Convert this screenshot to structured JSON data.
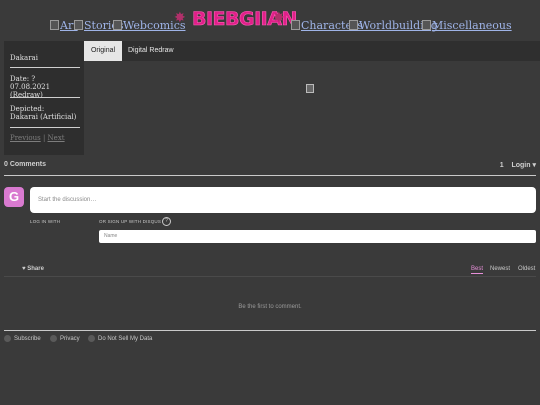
{
  "nav": {
    "links": [
      "Art",
      "Stories",
      "Webcomics",
      "Characters",
      "Worldbuilding",
      "Miscellaneous"
    ],
    "logo_text": "BIEBGIIAN"
  },
  "info": {
    "name": "Dakarai",
    "date_label": "Date: ?",
    "date_value": "07.08.2021 (Redraw)",
    "depicted_label": "Depicted:",
    "depicted_value": "Dakarai (Artificial)",
    "prev": "Previous",
    "separator": "|",
    "next": "Next"
  },
  "tabs": [
    "Original",
    "Digital Redraw"
  ],
  "comments": {
    "count_label": "0 Comments",
    "notif_count": "1",
    "login_label": "Login ▾",
    "avatar_letter": "G",
    "placeholder": "Start the discussion…",
    "log_in_with": "LOG IN WITH",
    "sign_up": "OR SIGN UP WITH DISQUS",
    "help": "?",
    "name_placeholder": "Name",
    "share": "Share",
    "sort": [
      "Best",
      "Newest",
      "Oldest"
    ],
    "empty": "Be the first to comment.",
    "footer": [
      "Subscribe",
      "Privacy",
      "Do Not Sell My Data"
    ]
  }
}
